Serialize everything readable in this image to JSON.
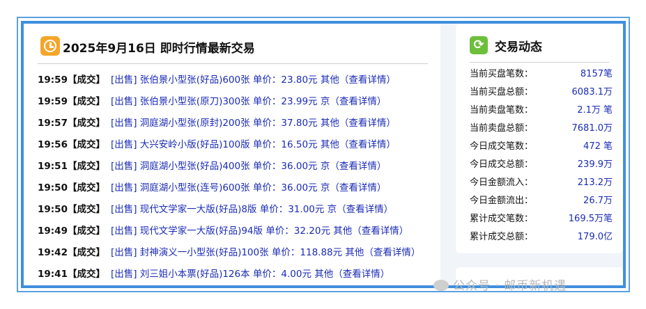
{
  "left_panel": {
    "title": "2025年9月16日 即时行情最新交易",
    "trades": [
      {
        "time": "19:59",
        "status": "【成交】",
        "desc": "[出售] 张伯景小型张(好品)600张 单价：23.80元 其他（查看详情）"
      },
      {
        "time": "19:59",
        "status": "【成交】",
        "desc": "[出售] 张伯景小型张(原刀)300张 单价：23.99元 京（查看详情）"
      },
      {
        "time": "19:57",
        "status": "【成交】",
        "desc": "[出售] 洞庭湖小型张(原封)200张 单价：37.80元 其他（查看详情）"
      },
      {
        "time": "19:56",
        "status": "【成交】",
        "desc": "[出售] 大兴安岭小版(好品)100版 单价：16.50元 其他（查看详情）"
      },
      {
        "time": "19:51",
        "status": "【成交】",
        "desc": "[出售] 洞庭湖小型张(好品)400张 单价：36.00元 京（查看详情）"
      },
      {
        "time": "19:50",
        "status": "【成交】",
        "desc": "[出售] 洞庭湖小型张(连号)600张 单价：36.00元 京（查看详情）"
      },
      {
        "time": "19:50",
        "status": "【成交】",
        "desc": "[出售] 现代文学家一大版(好品)8版 单价：31.00元 京（查看详情）"
      },
      {
        "time": "19:49",
        "status": "【成交】",
        "desc": "[出售] 现代文学家一大版(好品)94版 单价：32.20元 其他（查看详情）"
      },
      {
        "time": "19:42",
        "status": "【成交】",
        "desc": "[出售] 封神演义一小型张(好品)100张 单价：118.88元 其他（查看详情）"
      },
      {
        "time": "19:41",
        "status": "【成交】",
        "desc": "[出售] 刘三姐小本票(好品)126本 单价：4.00元 其他（查看详情）"
      }
    ]
  },
  "right_panel": {
    "title": "交易动态",
    "stats": [
      {
        "label": "当前买盘笔数：",
        "value": "8157笔"
      },
      {
        "label": "当前买盘总额：",
        "value": "6083.1万"
      },
      {
        "label": "当前卖盘笔数：",
        "value": "2.1万 笔"
      },
      {
        "label": "当前卖盘总额：",
        "value": "7681.0万"
      },
      {
        "label": "今日成交笔数：",
        "value": "472 笔"
      },
      {
        "label": "今日成交总额：",
        "value": "239.9万"
      },
      {
        "label": "今日金额流入：",
        "value": "213.2万"
      },
      {
        "label": "今日金额流出：",
        "value": "26.7万"
      },
      {
        "label": "累计成交笔数：",
        "value": "169.5万笔"
      },
      {
        "label": "累计成交总额：",
        "value": "179.0亿"
      }
    ]
  },
  "watermark": "公众号 · 邮币新机遇",
  "icons": {
    "left": "clock-icon",
    "right": "recycle-icon"
  },
  "colors": {
    "link": "#1a2bb5",
    "border": "#3f8fde",
    "clock": "#f4a52a",
    "recycle": "#6cbf3a"
  }
}
